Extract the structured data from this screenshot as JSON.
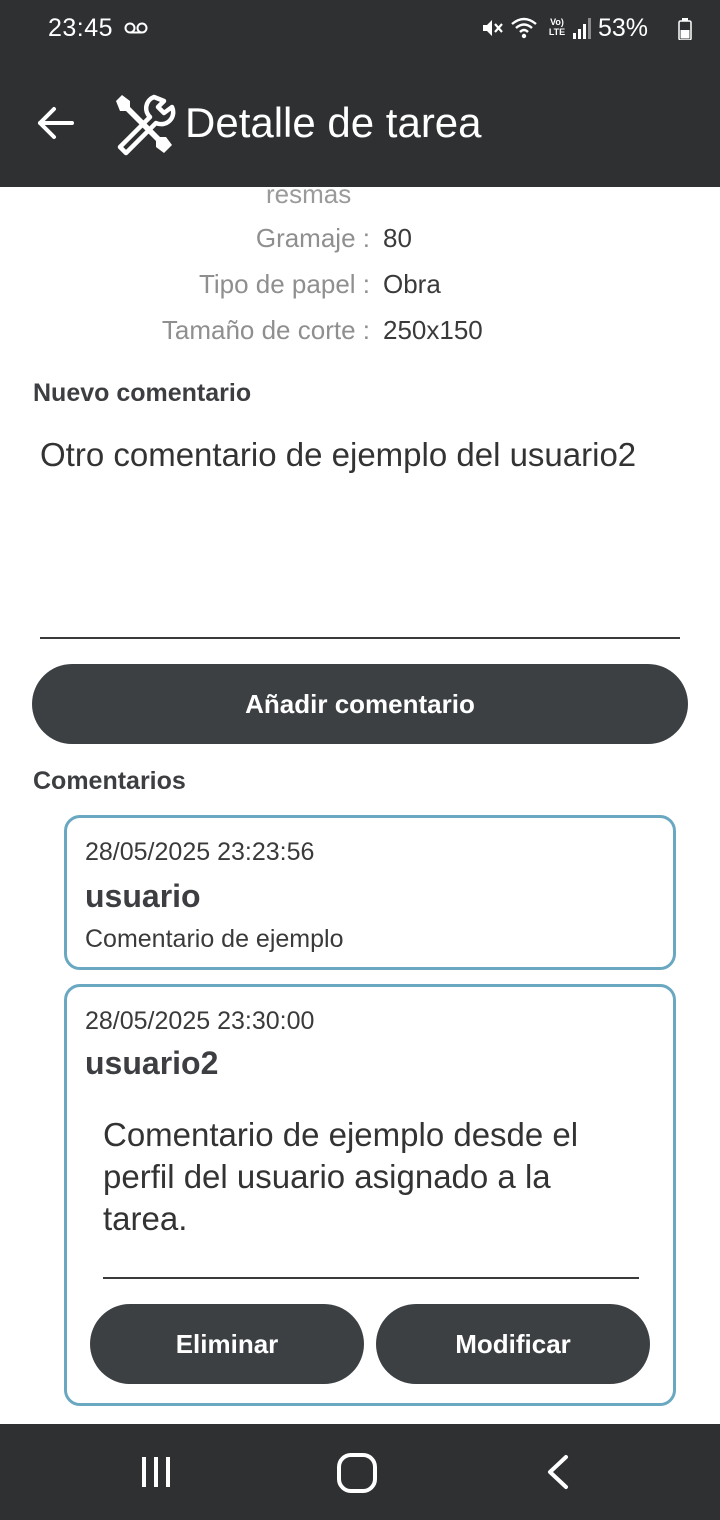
{
  "status_bar": {
    "time": "23:45",
    "battery": "53%",
    "network": "Vo) LTE",
    "icons": [
      "voicemail-icon",
      "mute-icon",
      "wifi-icon",
      "lte-icon",
      "signal-icon",
      "battery-icon"
    ]
  },
  "app_bar": {
    "title": "Detalle de tarea",
    "icons": [
      "back-arrow-icon",
      "tools-icon"
    ]
  },
  "details": {
    "partial_label": "resmas",
    "rows": [
      {
        "label": "Gramaje :",
        "value": "80"
      },
      {
        "label": "Tipo de papel :",
        "value": "Obra"
      },
      {
        "label": "Tamaño de corte :",
        "value": "250x150"
      }
    ]
  },
  "new_comment": {
    "heading": "Nuevo comentario",
    "value": "Otro comentario de ejemplo del usuario2",
    "submit_label": "Añadir comentario"
  },
  "comments": {
    "heading": "Comentarios",
    "items": [
      {
        "date": "28/05/2025 23:23:56",
        "user": "usuario",
        "text": "Comentario de ejemplo"
      },
      {
        "date": "28/05/2025 23:30:00",
        "user": "usuario2",
        "text": "Comentario de ejemplo desde el perfil del usuario asignado a la tarea.",
        "delete_label": "Eliminar",
        "edit_label": "Modificar"
      }
    ]
  },
  "nav_bar": {
    "icons": [
      "recents-icon",
      "home-icon",
      "back-icon"
    ]
  },
  "colors": {
    "bar_background": "#2e3032",
    "button_background": "#3c4043",
    "card_border": "#6aa8c1"
  }
}
